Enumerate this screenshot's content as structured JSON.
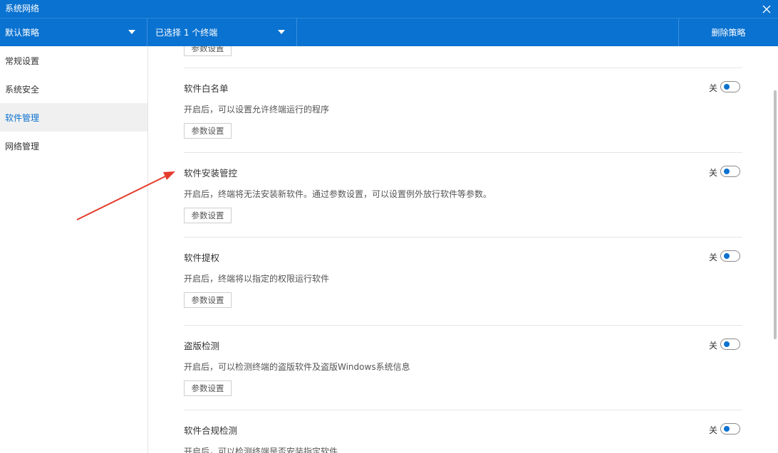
{
  "window": {
    "title": "系统网络"
  },
  "toolbar": {
    "strategy": "默认策略",
    "terminals": "已选择 1 个终端",
    "delete": "删除策略"
  },
  "sidebar": {
    "items": [
      {
        "label": "常规设置"
      },
      {
        "label": "系统安全"
      },
      {
        "label": "软件管理",
        "active": true
      },
      {
        "label": "网络管理"
      }
    ]
  },
  "content": {
    "top_button": "参数设置",
    "sections": [
      {
        "title": "软件白名单",
        "desc": "开启后，可以设置允许终端运行的程序",
        "button": "参数设置",
        "toggle_label": "关",
        "toggle_on": false
      },
      {
        "title": "软件安装管控",
        "desc": "开启后，终端将无法安装新软件。通过参数设置，可以设置例外放行软件等参数。",
        "button": "参数设置",
        "toggle_label": "关",
        "toggle_on": false
      },
      {
        "title": "软件提权",
        "desc": "开启后，终端将以指定的权限运行软件",
        "button": "参数设置",
        "toggle_label": "关",
        "toggle_on": false
      },
      {
        "title": "盗版检测",
        "desc": "开启后，可以检测终端的盗版软件及盗版Windows系统信息",
        "button": "参数设置",
        "toggle_label": "关",
        "toggle_on": false
      },
      {
        "title": "软件合规检测",
        "desc": "开启后，可以检测终端是否安装指定软件",
        "toggle_label": "关",
        "toggle_on": false
      }
    ]
  },
  "colors": {
    "accent": "#0a72d0",
    "arrow": "#e53c2e"
  },
  "icons": {
    "close": "close-icon",
    "dropdown": "caret-down-icon"
  }
}
